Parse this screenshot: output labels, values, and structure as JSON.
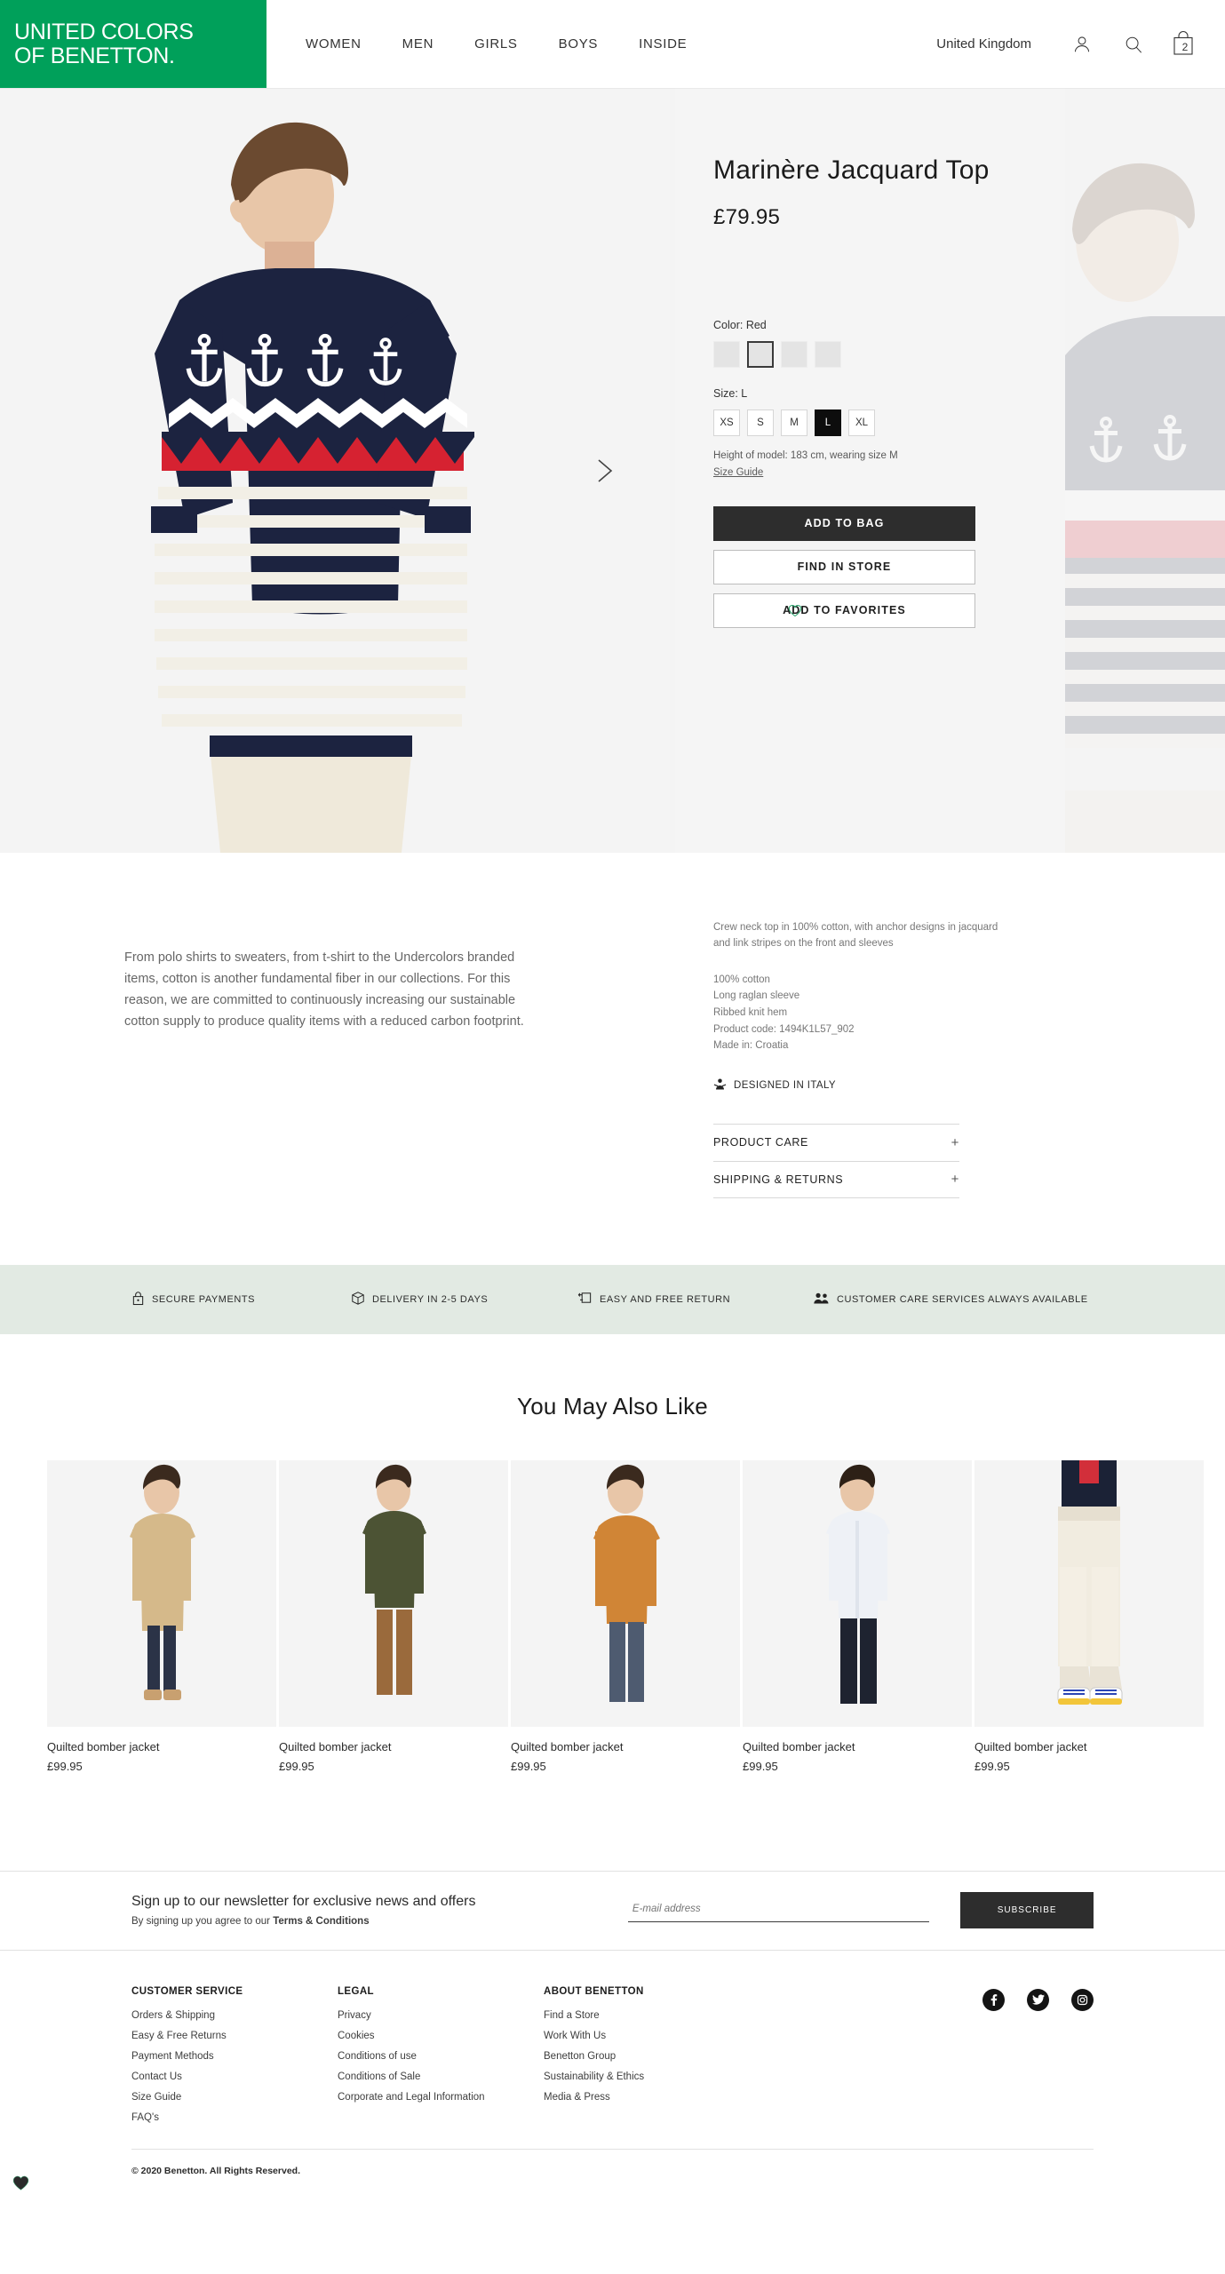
{
  "header": {
    "logo_line1": "UNITED COLORS",
    "logo_line2": "OF BENETTON.",
    "brand_color": "#00a05a",
    "nav": [
      "WOMEN",
      "MEN",
      "GIRLS",
      "BOYS",
      "INSIDE"
    ],
    "country": "United Kingdom",
    "icons": [
      "account-icon",
      "search-icon",
      "bag-icon"
    ],
    "bag_count": "2"
  },
  "product": {
    "title": "Marinère Jacquard Top",
    "price": "£79.95",
    "color_label": "Color: Red",
    "color_swatches": [
      "swatch-1",
      "swatch-2",
      "swatch-3",
      "swatch-4"
    ],
    "selected_swatch_index": 1,
    "size_label": "Size: L",
    "sizes": [
      "XS",
      "S",
      "M",
      "L",
      "XL"
    ],
    "selected_size": "L",
    "model_note": "Height of model: 183 cm, wearing size M",
    "size_guide": "Size Guide",
    "add_to_bag": "ADD TO BAG",
    "find_in_store": "FIND IN STORE",
    "add_to_favorites": "ADD TO FAVORITES",
    "next_arrow": "chevron-right-icon"
  },
  "description": {
    "left_paragraph": "From polo shirts to sweaters, from t-shirt to the Undercolors branded items, cotton is another fundamental fiber in our collections. For this reason, we are committed to continuously increasing our sustainable cotton supply to produce quality items with a reduced carbon footprint.",
    "headline": "Crew neck top in 100% cotton, with anchor designs in jacquard and link stripes on the front and sleeves",
    "specs": [
      "100% cotton",
      "Long raglan sleeve",
      "Ribbed knit hem",
      "Product code: 1494K1L57_902",
      "Made in: Croatia"
    ],
    "designed_in": "DESIGNED IN ITALY",
    "accordions": [
      {
        "label": "PRODUCT CARE",
        "toggle": "+"
      },
      {
        "label": "SHIPPING & RETURNS",
        "toggle": "+"
      }
    ]
  },
  "services": {
    "background": "#e2eae3",
    "items": [
      {
        "icon": "lock-icon",
        "label": "SECURE PAYMENTS"
      },
      {
        "icon": "box-icon",
        "label": "DELIVERY IN 2-5 DAYS"
      },
      {
        "icon": "return-icon",
        "label": "EASY AND FREE RETURN"
      },
      {
        "icon": "people-icon",
        "label": "CUSTOMER CARE SERVICES ALWAYS AVAILABLE"
      }
    ]
  },
  "recommendations": {
    "title": "You May Also Like",
    "cards": [
      {
        "name": "Quilted bomber jacket",
        "price": "£99.95",
        "favorited": false
      },
      {
        "name": "Quilted bomber jacket",
        "price": "£99.95",
        "favorited": false
      },
      {
        "name": "Quilted bomber jacket",
        "price": "£99.95",
        "favorited": false
      },
      {
        "name": "Quilted bomber jacket",
        "price": "£99.95",
        "favorited": false
      },
      {
        "name": "Quilted bomber jacket",
        "price": "£99.95",
        "favorited": true
      }
    ]
  },
  "newsletter": {
    "heading": "Sign up to our newsletter for exclusive news and offers",
    "subtext_before": "By signing up you agree to our ",
    "subtext_bold": "Terms & Conditions",
    "input_placeholder": "E-mail address",
    "input_value": "",
    "button": "SUBSCRIBE"
  },
  "footer": {
    "columns": [
      {
        "title": "CUSTOMER SERVICE",
        "links": [
          "Orders & Shipping",
          "Easy & Free Returns",
          "Payment Methods",
          "Contact Us",
          "Size Guide",
          "FAQ's"
        ]
      },
      {
        "title": "LEGAL",
        "links": [
          "Privacy",
          "Cookies",
          "Conditions of use",
          "Conditions of Sale",
          "Corporate and Legal Information"
        ]
      },
      {
        "title": "ABOUT BENETTON",
        "links": [
          "Find a Store",
          "Work With Us",
          "Benetton Group",
          "Sustainability & Ethics",
          "Media & Press"
        ]
      }
    ],
    "socials": [
      "facebook-icon",
      "twitter-icon",
      "instagram-icon"
    ],
    "copyright": "© 2020 Benetton. All Rights Reserved."
  }
}
